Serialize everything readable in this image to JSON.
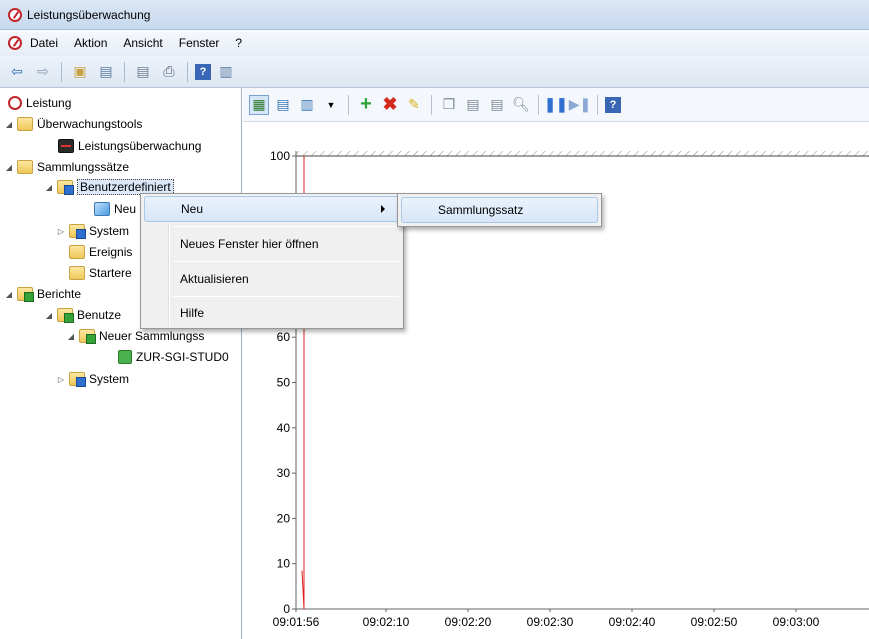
{
  "window": {
    "title": "Leistungsüberwachung",
    "icon": "performance-gauge-icon"
  },
  "menubar": {
    "items": [
      "Datei",
      "Aktion",
      "Ansicht",
      "Fenster",
      "?"
    ]
  },
  "toolbar": {
    "icons": [
      "back-arrow-icon",
      "forward-arrow-icon",
      "up-folder-icon",
      "show-hide-tree-icon",
      "properties-icon",
      "print-icon",
      "help-icon",
      "show-hide-action-icon"
    ]
  },
  "tree": {
    "root": "Leistung",
    "tools_folder": "Überwachungstools",
    "perf_monitor": "Leistungsüberwachung",
    "collection_sets": "Sammlungssätze",
    "user_defined": "Benutzerdefiniert",
    "new_set_truncated": "Neu",
    "system": "System",
    "event_trace": "Ereignis",
    "startup_event": "Startere",
    "reports": "Berichte",
    "reports_user": "Benutze",
    "new_collection_truncated": "Neuer Sammlungss",
    "report_item": "ZUR-SGI-STUD0",
    "reports_system": "System"
  },
  "context_menu": {
    "items": [
      {
        "label": "Neu",
        "has_submenu": true
      },
      {
        "label": "Neues Fenster hier öffnen"
      },
      {
        "label": "Aktualisieren"
      },
      {
        "label": "Hilfe"
      }
    ],
    "submenu": {
      "label": "Sammlungssatz"
    }
  },
  "graph_toolbar": {
    "icons": [
      "view-graph-icon",
      "view-histogram-icon",
      "change-graph-type-icon",
      "dropdown-icon",
      "add-counter-icon",
      "delete-counter-icon",
      "highlight-icon",
      "copy-properties-icon",
      "paste-counter-list-icon",
      "properties-icon",
      "zoom-icon",
      "freeze-display-icon",
      "update-data-icon",
      "help-icon"
    ]
  },
  "chart_data": {
    "type": "line",
    "ylim": [
      0,
      100
    ],
    "yticks": [
      0,
      10,
      20,
      30,
      40,
      50,
      60,
      100
    ],
    "ytick_labels": [
      "0",
      "10",
      "20",
      "30",
      "40",
      "50",
      "60",
      "100"
    ],
    "xtick_labels": [
      "09:01:56",
      "09:02:10",
      "09:02:20",
      "09:02:30",
      "09:02:40",
      "09:02:50",
      "09:03:00"
    ],
    "series": [
      {
        "color": "#e02020",
        "points": [
          [
            0,
            8.5
          ],
          [
            4,
            0
          ],
          [
            4,
            100
          ]
        ]
      }
    ],
    "line_color": "#e02020"
  }
}
